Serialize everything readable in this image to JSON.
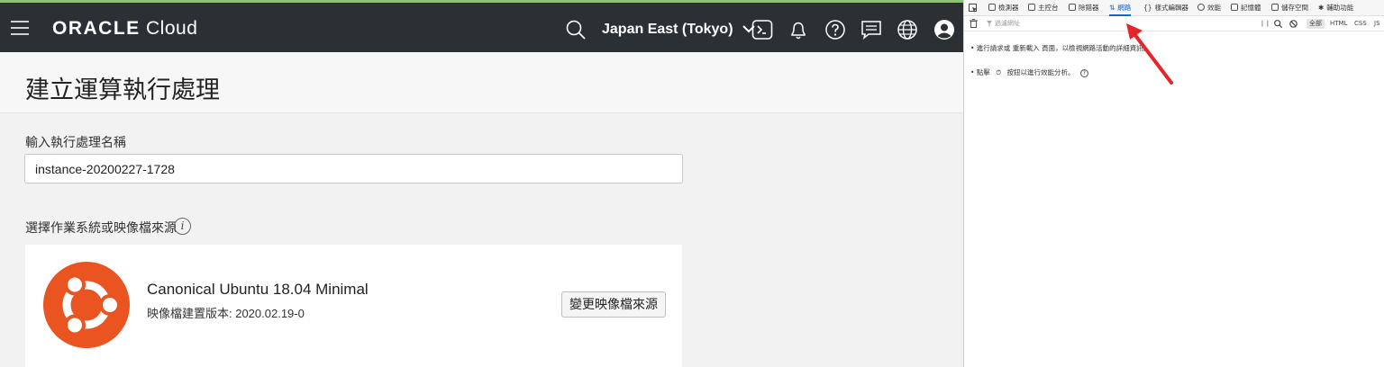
{
  "header": {
    "logo_bold": "ORACLE",
    "logo_light": " Cloud",
    "region": "Japan East (Tokyo)",
    "icons": [
      "menu-icon",
      "search-icon",
      "chevron-down-icon",
      "cloud-shell-icon",
      "bell-icon",
      "help-icon",
      "chat-icon",
      "globe-icon",
      "user-avatar-icon"
    ]
  },
  "page": {
    "title": "建立運算執行處理",
    "name_label": "輸入執行處理名稱",
    "name_value": "instance-20200227-1728",
    "source_label": "選擇作業系統或映像檔來源",
    "info_glyph": "i"
  },
  "image": {
    "name": "Canonical Ubuntu 18.04 Minimal",
    "build": "映像檔建置版本: 2020.02.19-0",
    "change_button": "變更映像檔來源",
    "logo_color": "#e95420"
  },
  "devtools": {
    "tabs": [
      {
        "label": "檢測器",
        "icon": "inspector-icon"
      },
      {
        "label": "主控台",
        "icon": "console-icon"
      },
      {
        "label": "除錯器",
        "icon": "debugger-icon"
      },
      {
        "label": "網路",
        "icon": "network-icon"
      },
      {
        "label": "樣式編輯器",
        "icon": "style-editor-icon"
      },
      {
        "label": "效能",
        "icon": "performance-icon"
      },
      {
        "label": "記憶體",
        "icon": "memory-icon"
      },
      {
        "label": "儲存空間",
        "icon": "storage-icon"
      },
      {
        "label": "輔助功能",
        "icon": "accessibility-icon"
      }
    ],
    "active_tab": "網路",
    "filter_placeholder": "過濾網址",
    "type_filters": [
      "全部",
      "HTML",
      "CSS",
      "JS"
    ],
    "selected_type": "全部",
    "message_1": "• 進行請求或  重新載入  頁面，以檢視網路活動的詳細資訊。",
    "message_2_prefix": "• 點擊",
    "message_2_suffix": "按鈕以進行效能分析。",
    "accent_color": "#0a66d8",
    "annotation_arrow_color": "#e8232a"
  }
}
